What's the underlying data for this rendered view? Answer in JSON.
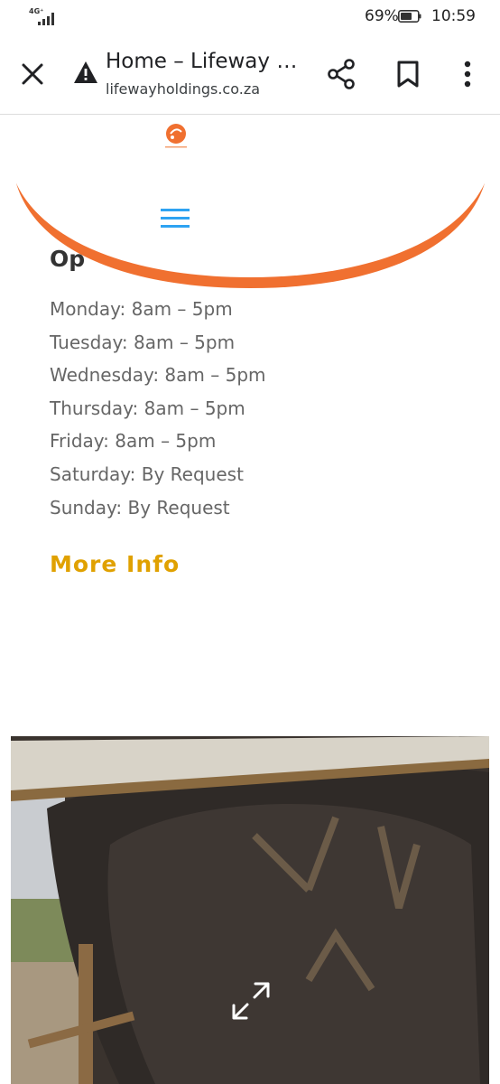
{
  "status_bar": {
    "network": "4G⁺",
    "battery_percent": "69%",
    "time": "10:59"
  },
  "toolbar": {
    "title": "Home – Lifeway …",
    "url": "lifewayholdings.co.za",
    "icons": [
      "close-icon",
      "warning-icon",
      "share-icon",
      "bookmark-icon",
      "more-vert-icon"
    ]
  },
  "header": {
    "logo_icon": "lifeway-logo",
    "menu_icon": "hamburger-menu-icon",
    "accent_color": "#f07030",
    "menu_color": "#2ea3f2"
  },
  "content": {
    "heading_partial": "Op",
    "hours": [
      "Monday: 8am – 5pm",
      "Tuesday: 8am – 5pm",
      "Wednesday: 8am – 5pm",
      "Thursday: 8am – 5pm",
      "Friday: 8am – 5pm",
      "Saturday: By Request",
      "Sunday: By Request"
    ],
    "more_info_label": "More Info",
    "more_info_color": "#e0a100"
  },
  "photo": {
    "subject_icon": "cattle-brand-photo",
    "overlay_icon": "expand-icon"
  }
}
